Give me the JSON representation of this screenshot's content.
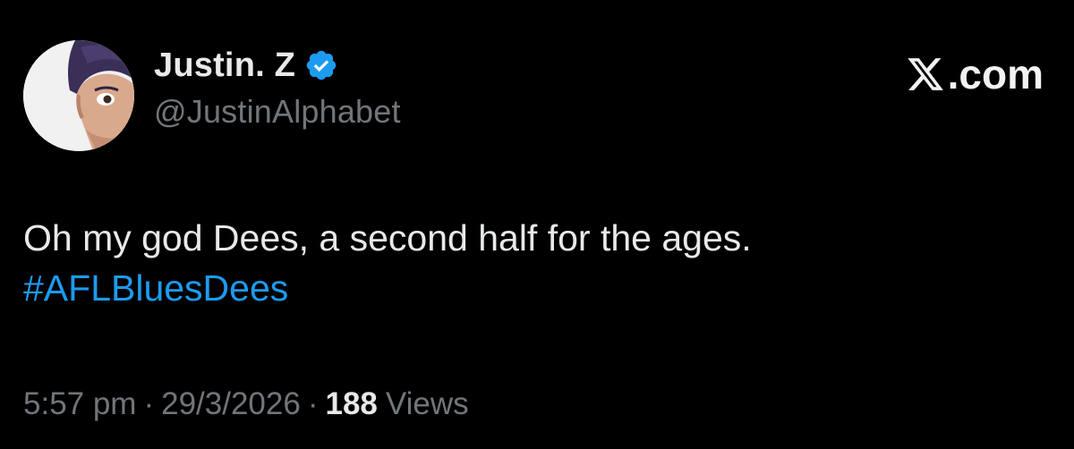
{
  "author": {
    "display_name": "Justin. Z",
    "handle": "@JustinAlphabet",
    "verified_icon": "verified-badge-icon",
    "avatar_icon": "profile-avatar"
  },
  "brand": {
    "domain": ".com",
    "logo_icon": "x-logo-icon"
  },
  "tweet": {
    "line1": "Oh my god Dees, a second half for the ages.",
    "hashtag": "#AFLBluesDees"
  },
  "meta": {
    "time": "5:57 pm",
    "separator": "·",
    "date": "29/3/2026",
    "views_count": "188",
    "views_label": "Views"
  },
  "colors": {
    "background": "#000000",
    "primary_text": "#e7e9ea",
    "secondary_text": "#71767b",
    "link": "#1d9bf0",
    "verified": "#1d9bf0"
  }
}
